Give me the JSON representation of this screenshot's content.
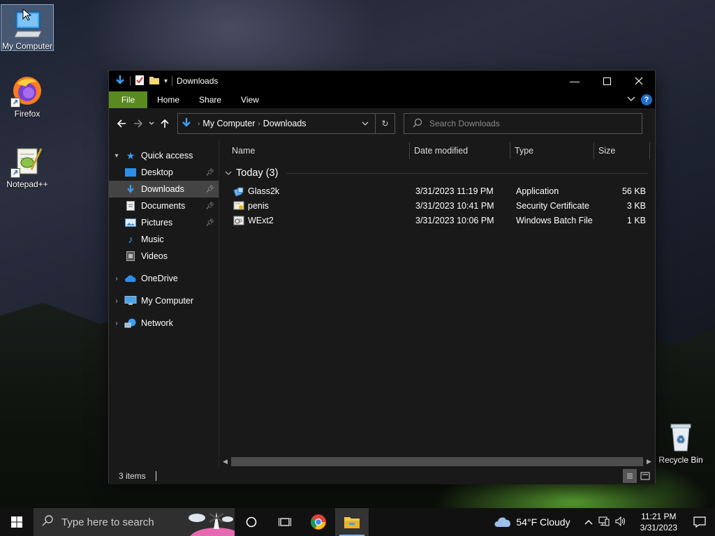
{
  "desktop": {
    "icons": [
      {
        "label": "My Computer"
      },
      {
        "label": "Firefox"
      },
      {
        "label": "Notepad++"
      },
      {
        "label": "Recycle Bin"
      }
    ]
  },
  "window": {
    "title": "Downloads",
    "ribbon_tabs": [
      "File",
      "Home",
      "Share",
      "View"
    ],
    "help_label": "?",
    "breadcrumb": [
      "My Computer",
      "Downloads"
    ],
    "search_placeholder": "Search Downloads",
    "nav": {
      "quick_access": "Quick access",
      "items": [
        {
          "label": "Desktop",
          "pinned": true
        },
        {
          "label": "Downloads",
          "pinned": true,
          "selected": true
        },
        {
          "label": "Documents",
          "pinned": true
        },
        {
          "label": "Pictures",
          "pinned": true
        },
        {
          "label": "Music",
          "pinned": false
        },
        {
          "label": "Videos",
          "pinned": false
        }
      ],
      "onedrive": "OneDrive",
      "my_computer": "My Computer",
      "network": "Network"
    },
    "columns": [
      "Name",
      "Date modified",
      "Type",
      "Size"
    ],
    "group_label": "Today (3)",
    "files": [
      {
        "name": "Glass2k",
        "date": "3/31/2023 11:19 PM",
        "type": "Application",
        "size": "56 KB",
        "icon": "application-icon"
      },
      {
        "name": "penis",
        "date": "3/31/2023 10:41 PM",
        "type": "Security Certificate",
        "size": "3 KB",
        "icon": "certificate-icon"
      },
      {
        "name": "WExt2",
        "date": "3/31/2023 10:06 PM",
        "type": "Windows Batch File",
        "size": "1 KB",
        "icon": "batch-file-icon"
      }
    ],
    "status": "3 items"
  },
  "taskbar": {
    "search_placeholder": "Type here to search",
    "weather": "54°F  Cloudy",
    "time": "11:21 PM",
    "date": "3/31/2023"
  },
  "colors": {
    "file_tab": "#5a8a1e",
    "accent": "#1e6fc9",
    "window_bg": "#191919",
    "taskbar_bg": "#111111"
  }
}
